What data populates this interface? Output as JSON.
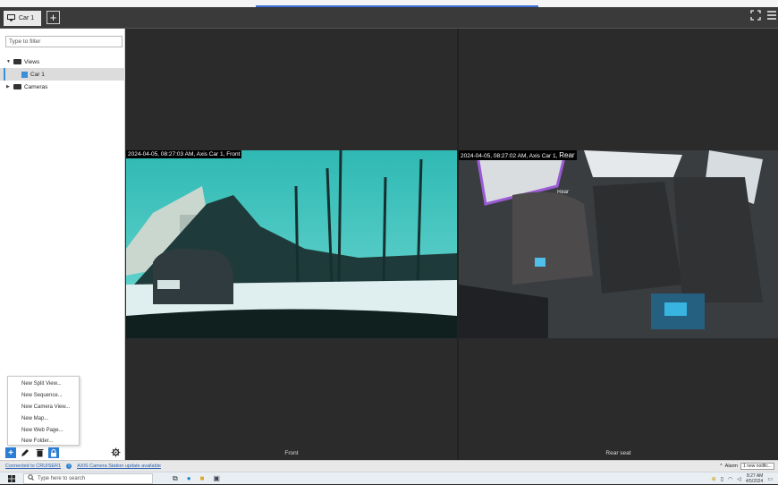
{
  "tabbar": {
    "tab_label": "Car 1",
    "add_tab_glyph": "+"
  },
  "sidebar": {
    "filter_placeholder": "Type to filter",
    "tree": {
      "views_label": "Views",
      "car1_label": "Car 1",
      "cameras_label": "Cameras"
    },
    "menu": [
      "New Split View...",
      "New Sequence...",
      "New Camera View...",
      "New Map...",
      "New Web Page...",
      "New Folder..."
    ]
  },
  "panes": {
    "front": {
      "overlay": "2024-04-05, 08:27:03 AM, Axis Car 1, Front",
      "label": "Front"
    },
    "rear": {
      "overlay": "2024-04-05, 08:27:02 AM, Axis Car 1, ",
      "overlay_big": "Rear",
      "label": "Rear seat",
      "watermark": "Rear"
    }
  },
  "statusbar": {
    "connected": "Connected to CRUISER1",
    "update": "AXIS Camera Station update available",
    "alarm_label": "Alarm",
    "notification": "1 new notific..."
  },
  "taskbar": {
    "search_placeholder": "Type here to search",
    "time": "8:27 AM",
    "date": "4/5/2024"
  },
  "colors": {
    "accent": "#2a7fd4",
    "selection": "#dcdcdc",
    "video_bg": "#2b2b2b"
  }
}
